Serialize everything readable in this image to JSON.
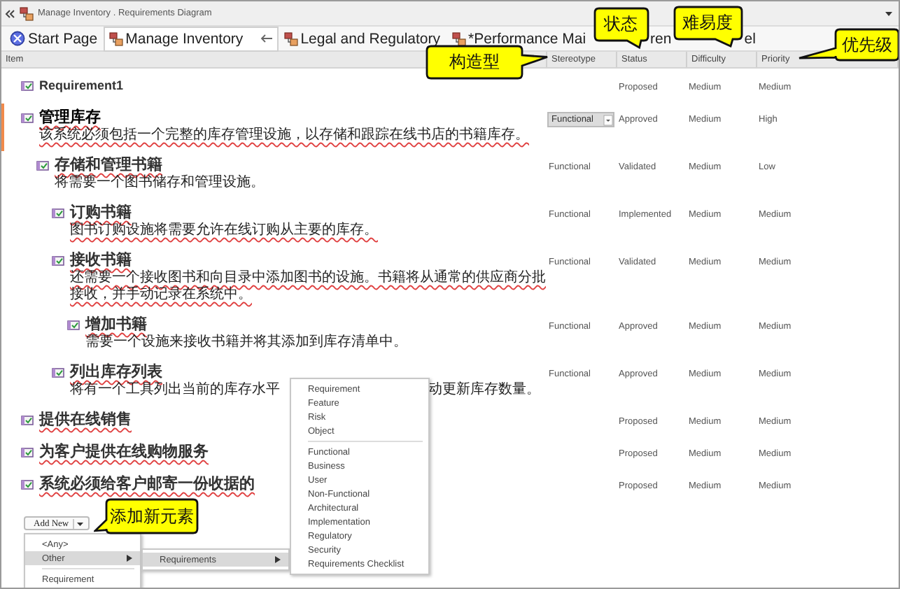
{
  "window": {
    "title": "Manage Inventory . Requirements Diagram"
  },
  "tabs": [
    {
      "label": "Start Page",
      "kind": "start",
      "selected": false
    },
    {
      "label": "Manage Inventory",
      "kind": "diagram",
      "selected": true
    },
    {
      "label": "Legal and Regulatory",
      "kind": "diagram",
      "selected": false
    },
    {
      "label": "*Performance Mai",
      "kind": "diagram",
      "selected": false
    }
  ],
  "tab_fragments": [
    "ren",
    "el"
  ],
  "columns": [
    "Item",
    "Stereotype",
    "Status",
    "Difficulty",
    "Priority"
  ],
  "requirements": [
    {
      "name": "Requirement1",
      "name_flagged": false,
      "status": "Proposed",
      "difficulty": "Medium",
      "priority": "Medium",
      "selected": false
    },
    {
      "name": "管理库存",
      "name_flagged": true,
      "description": "该系统必须包括一个完整的库存管理设施，以存储和跟踪在线书店的书籍库存。",
      "description_flagged": true,
      "stereotype": "Functional",
      "status": "Approved",
      "difficulty": "Medium",
      "priority": "High",
      "selected": true,
      "children": [
        {
          "name": "存储和管理书籍",
          "name_flagged": true,
          "description": "将需要一个图书储存和管理设施。",
          "description_flagged": false,
          "stereotype": "Functional",
          "status": "Validated",
          "difficulty": "Medium",
          "priority": "Low",
          "selected": false,
          "children": [
            {
              "name": "订购书籍",
              "name_flagged": true,
              "description": "图书订购设施将需要允许在线订购从主要的库存。",
              "description_flagged": true,
              "stereotype": "Functional",
              "status": "Implemented",
              "difficulty": "Medium",
              "priority": "Medium",
              "selected": false
            },
            {
              "name": "接收书籍",
              "name_flagged": true,
              "description": "还需要一个接收图书和向目录中添加图书的设施。书籍将从通常的供应商分批接收，并手动记录在系统中。",
              "description_flagged": true,
              "stereotype": "Functional",
              "status": "Validated",
              "difficulty": "Medium",
              "priority": "Medium",
              "selected": false,
              "children": [
                {
                  "name": "增加书籍",
                  "name_flagged": true,
                  "description": "需要一个设施来接收书籍并将其添加到库存清单中。",
                  "description_flagged": false,
                  "stereotype": "Functional",
                  "status": "Approved",
                  "difficulty": "Medium",
                  "priority": "Medium",
                  "selected": false
                }
              ]
            },
            {
              "name": "列出库存列表",
              "name_flagged": true,
              "description_parts": [
                "将有一个工具列出当前的库存水平",
                "动更新库存数量。"
              ],
              "description_flagged": false,
              "stereotype": "Functional",
              "status": "Approved",
              "difficulty": "Medium",
              "priority": "Medium",
              "selected": false
            }
          ]
        }
      ]
    },
    {
      "name": "提供在线销售",
      "name_flagged": true,
      "status": "Proposed",
      "difficulty": "Medium",
      "priority": "Medium",
      "selected": false
    },
    {
      "name": "为客户提供在线购物服务",
      "name_flagged": true,
      "status": "Proposed",
      "difficulty": "Medium",
      "priority": "Medium",
      "selected": false
    },
    {
      "name": "系统必须给客户邮寄一份收据的",
      "name_flagged": true,
      "status": "Proposed",
      "difficulty": "Medium",
      "priority": "Medium",
      "selected": false
    }
  ],
  "add_new": {
    "label": "Add New",
    "menu": [
      {
        "kind": "item",
        "label": "<Any>",
        "selected": false,
        "submenu": false
      },
      {
        "kind": "item",
        "label": "Other",
        "selected": true,
        "submenu": true
      },
      {
        "kind": "separator"
      },
      {
        "kind": "item",
        "label": "Requirement",
        "selected": false,
        "submenu": false
      }
    ],
    "submenu": [
      {
        "kind": "item",
        "label": "Requirements",
        "selected": true,
        "submenu": true
      }
    ],
    "type_menu": [
      {
        "kind": "item",
        "label": "Requirement",
        "selected": false
      },
      {
        "kind": "item",
        "label": "Feature",
        "selected": false
      },
      {
        "kind": "item",
        "label": "Risk",
        "selected": false
      },
      {
        "kind": "item",
        "label": "Object",
        "selected": false
      },
      {
        "kind": "separator"
      },
      {
        "kind": "item",
        "label": "Functional",
        "selected": false
      },
      {
        "kind": "item",
        "label": "Business",
        "selected": false
      },
      {
        "kind": "item",
        "label": "User",
        "selected": false
      },
      {
        "kind": "item",
        "label": "Non-Functional",
        "selected": false
      },
      {
        "kind": "item",
        "label": "Architectural",
        "selected": false
      },
      {
        "kind": "item",
        "label": "Implementation",
        "selected": false
      },
      {
        "kind": "item",
        "label": "Regulatory",
        "selected": false
      },
      {
        "kind": "item",
        "label": "Security",
        "selected": false
      },
      {
        "kind": "item",
        "label": "Requirements Checklist",
        "selected": false
      }
    ]
  },
  "callouts": [
    {
      "text": "构造型",
      "kind": "right"
    },
    {
      "text": "状态",
      "kind": "down"
    },
    {
      "text": "难易度",
      "kind": "down"
    },
    {
      "text": "优先级",
      "kind": "left"
    },
    {
      "text": "添加新元素",
      "kind": "left"
    }
  ]
}
